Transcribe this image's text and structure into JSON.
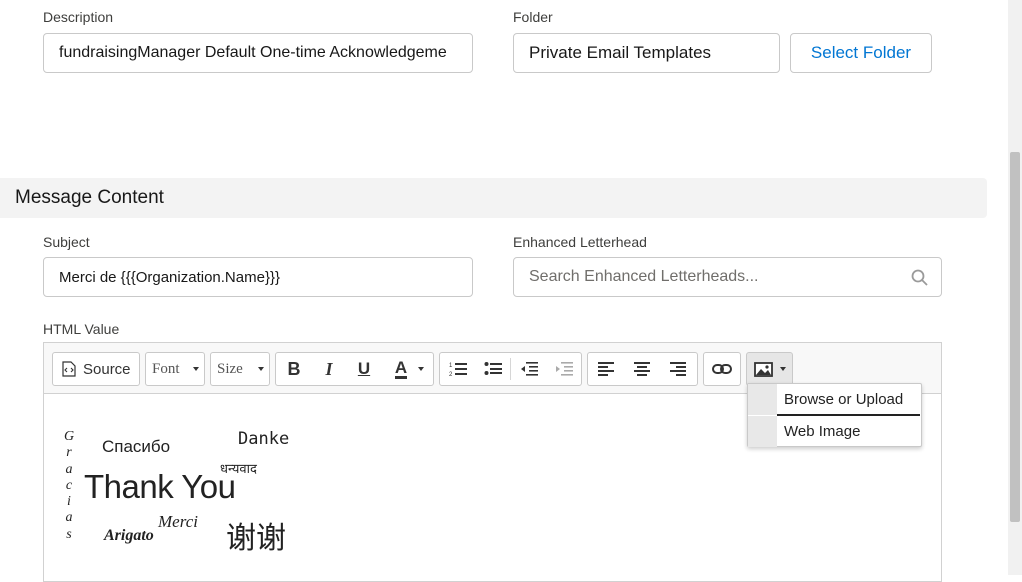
{
  "fields": {
    "description": {
      "label": "Description",
      "value": "fundraisingManager Default One-time Acknowledgeme"
    },
    "folder": {
      "label": "Folder",
      "value": "Private Email Templates",
      "button": "Select Folder"
    },
    "subject": {
      "label": "Subject",
      "value": "Merci de {{{Organization.Name}}}"
    },
    "letterhead": {
      "label": "Enhanced Letterhead",
      "placeholder": "Search Enhanced Letterheads..."
    },
    "html_value": {
      "label": "HTML Value"
    }
  },
  "section": {
    "title": "Message Content"
  },
  "toolbar": {
    "source": "Source",
    "font": "Font",
    "size": "Size",
    "icons": [
      "source-icon",
      "bold-icon",
      "italic-icon",
      "underline-icon",
      "text-color-icon",
      "numbered-list-icon",
      "bulleted-list-icon",
      "decrease-indent-icon",
      "increase-indent-icon",
      "align-left-icon",
      "align-center-icon",
      "align-right-icon",
      "link-icon",
      "image-icon"
    ]
  },
  "image_menu": {
    "items": [
      "Browse or Upload",
      "Web Image"
    ],
    "highlight_color": "#ffff00"
  },
  "thank_you_image": {
    "gracias": [
      "G",
      "r",
      "a",
      "c",
      "i",
      "a",
      "s"
    ],
    "spasibo": "Спасибо",
    "danke": "Danke",
    "dhanyavad": "धन्यवाद",
    "thank_you": "Thank You",
    "merci": "Merci",
    "arigato": "Arigato",
    "xiexie": "谢谢"
  },
  "colors": {
    "accent": "#0176d3",
    "section_bg": "#f3f3f3",
    "border": "#c9c9c9"
  }
}
